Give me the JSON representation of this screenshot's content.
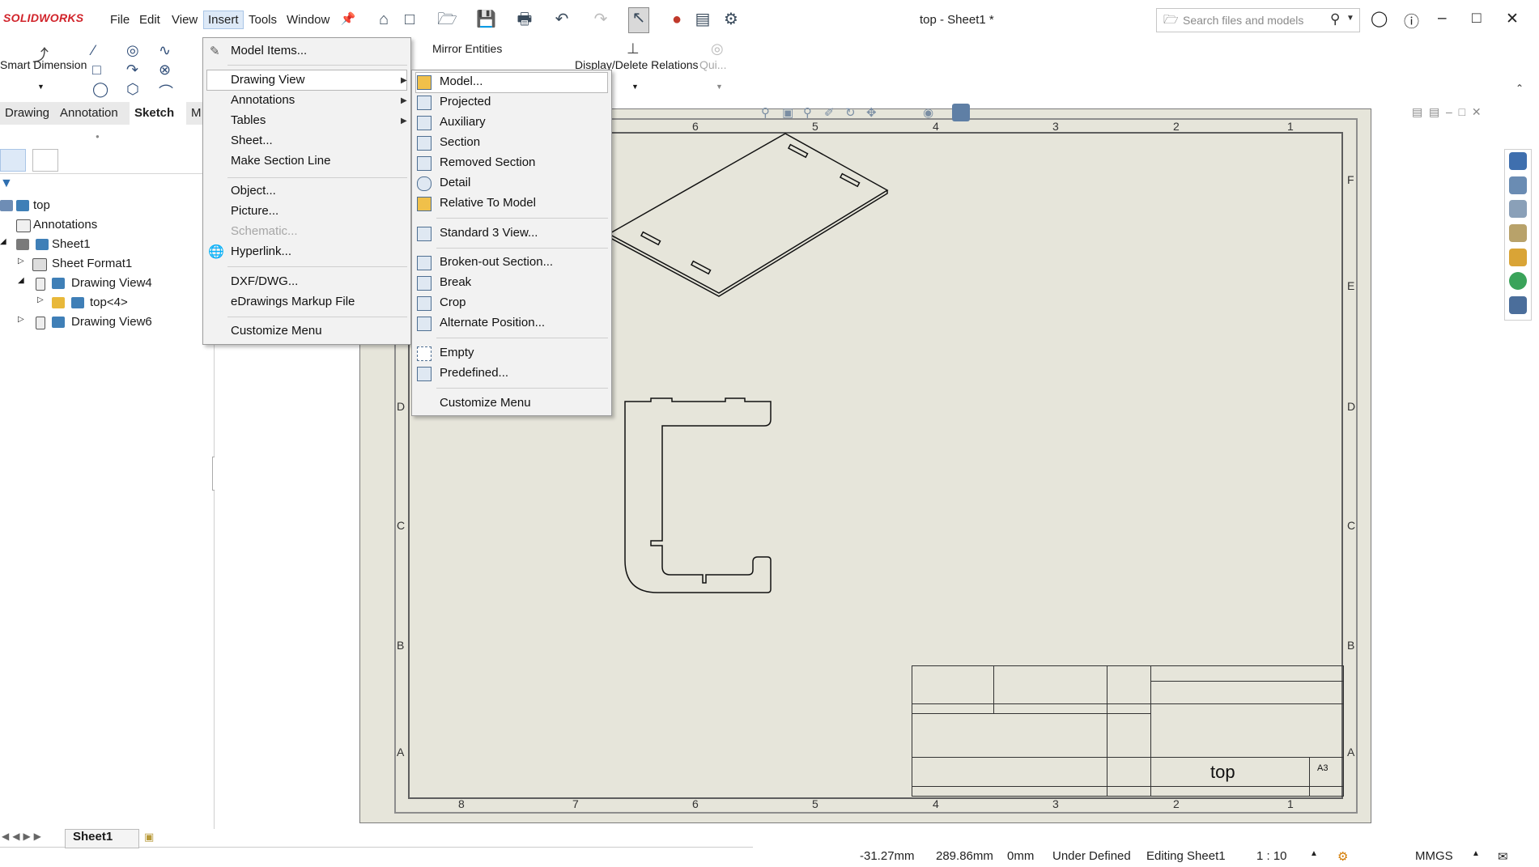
{
  "app": {
    "logo": "SOLIDWORKS",
    "doc_title": "top - Sheet1 *"
  },
  "menubar": [
    "File",
    "Edit",
    "View",
    "Insert",
    "Tools",
    "Window"
  ],
  "search": {
    "placeholder": "Search files and models"
  },
  "command_manager": {
    "smart_dimension": "Smart Dimension",
    "mirror_entities": "Mirror Entities",
    "display_delete_relations": "Display/Delete Relations",
    "quick": "Qui..."
  },
  "tabs": [
    "Drawing",
    "Annotation",
    "Sketch",
    "M"
  ],
  "tree": [
    {
      "label": "top",
      "level": 0
    },
    {
      "label": "Annotations",
      "level": 1
    },
    {
      "label": "Sheet1",
      "level": 1
    },
    {
      "label": "Sheet Format1",
      "level": 2
    },
    {
      "label": "Drawing View4",
      "level": 2
    },
    {
      "label": "top<4>",
      "level": 3
    },
    {
      "label": "Drawing View6",
      "level": 2
    }
  ],
  "insert_menu": [
    {
      "label": "Model Items...",
      "has_sub": false,
      "disabled": false
    },
    {
      "label": "Drawing View",
      "has_sub": true,
      "disabled": false
    },
    {
      "label": "Annotations",
      "has_sub": true,
      "disabled": false
    },
    {
      "label": "Tables",
      "has_sub": true,
      "disabled": false
    },
    {
      "label": "Sheet...",
      "has_sub": false,
      "disabled": false
    },
    {
      "label": "Make Section Line",
      "has_sub": false,
      "disabled": false
    },
    {
      "label": "Object...",
      "has_sub": false,
      "disabled": false
    },
    {
      "label": "Picture...",
      "has_sub": false,
      "disabled": false
    },
    {
      "label": "Schematic...",
      "has_sub": false,
      "disabled": true
    },
    {
      "label": "Hyperlink...",
      "has_sub": false,
      "disabled": false
    },
    {
      "label": "DXF/DWG...",
      "has_sub": false,
      "disabled": false
    },
    {
      "label": "eDrawings Markup File",
      "has_sub": false,
      "disabled": false
    },
    {
      "label": "Customize Menu",
      "has_sub": false,
      "disabled": false
    }
  ],
  "drawing_view_menu": [
    "Model...",
    "Projected",
    "Auxiliary",
    "Section",
    "Removed Section",
    "Detail",
    "Relative To Model",
    "Standard 3 View...",
    "Broken-out Section...",
    "Break",
    "Crop",
    "Alternate Position...",
    "Empty",
    "Predefined...",
    "Customize Menu"
  ],
  "sheet": {
    "zones_top": [
      "8",
      "7",
      "6",
      "5",
      "4",
      "3",
      "2",
      "1"
    ],
    "zones_side": [
      "F",
      "E",
      "D",
      "C",
      "B",
      "A"
    ],
    "title_block_name": "top",
    "size": "A3"
  },
  "status": {
    "sheet_tab": "Sheet1",
    "x": "-31.27mm",
    "y": "289.86mm",
    "z": "0mm",
    "state": "Under Defined",
    "editing": "Editing Sheet1",
    "scale": "1 : 10",
    "units": "MMGS"
  }
}
